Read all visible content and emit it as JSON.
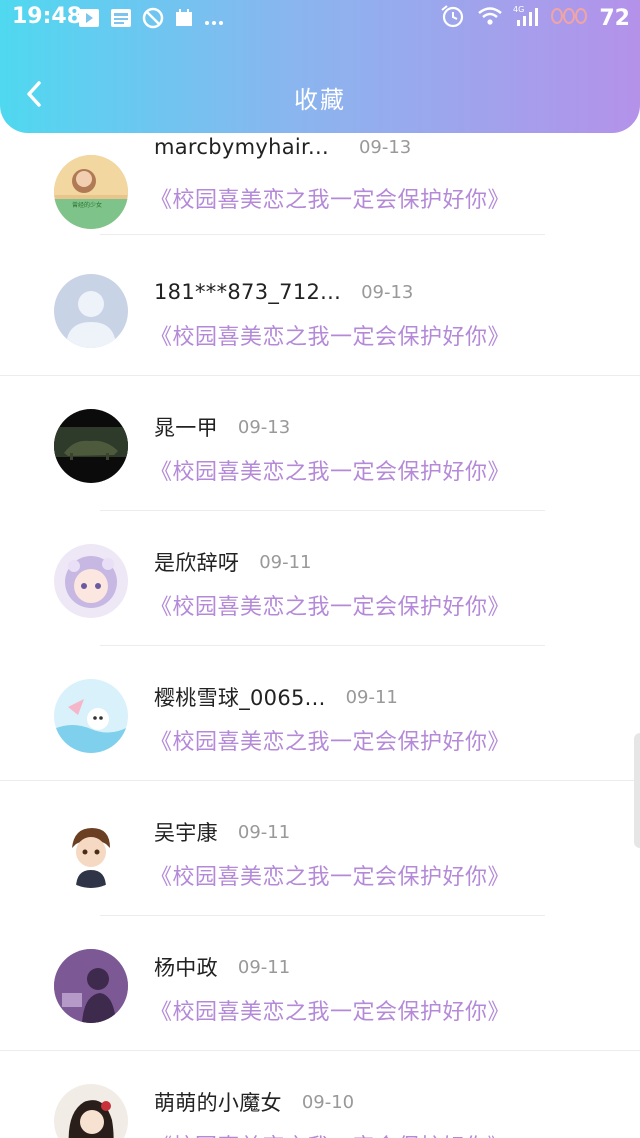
{
  "status_bar": {
    "time": "19:48",
    "battery": "72",
    "network": "4G"
  },
  "header": {
    "title": "收藏"
  },
  "favorites": [
    {
      "name": "marcbymyhair...",
      "date": "09-13",
      "title": "《校园喜美恋之我一定会保护好你》",
      "avatar_text": "曾经的少女"
    },
    {
      "name": "181***873_712...",
      "date": "09-13",
      "title": "《校园喜美恋之我一定会保护好你》"
    },
    {
      "name": "晁一甲",
      "date": "09-13",
      "title": "《校园喜美恋之我一定会保护好你》"
    },
    {
      "name": "是欣辞呀",
      "date": "09-11",
      "title": "《校园喜美恋之我一定会保护好你》"
    },
    {
      "name": "樱桃雪球_0065...",
      "date": "09-11",
      "title": "《校园喜美恋之我一定会保护好你》"
    },
    {
      "name": "吴宇康",
      "date": "09-11",
      "title": "《校园喜美恋之我一定会保护好你》"
    },
    {
      "name": "杨中政",
      "date": "09-11",
      "title": "《校园喜美恋之我一定会保护好你》"
    },
    {
      "name": "萌萌的小魔女",
      "date": "09-10",
      "title": "《校园喜美恋之我一定会保护好你》"
    }
  ],
  "colors": {
    "header_start": "#4fd8f0",
    "header_end": "#b492ea",
    "title_purple": "#b48ad8"
  }
}
